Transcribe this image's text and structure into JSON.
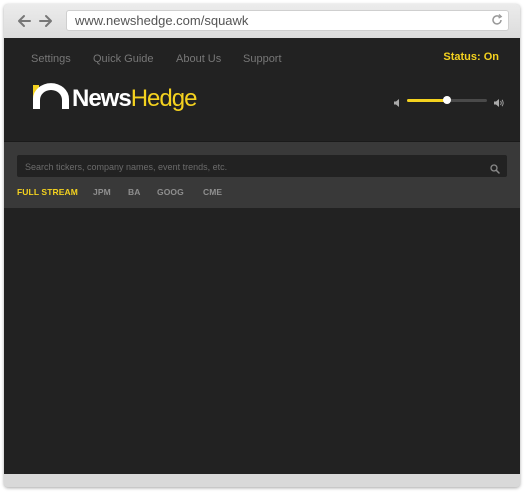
{
  "browser": {
    "url": "www.newshedge.com/squawk",
    "icons": {
      "back": "back-arrow-icon",
      "forward": "forward-arrow-icon",
      "reload": "reload-icon"
    }
  },
  "nav": {
    "links": [
      "Settings",
      "Quick Guide",
      "About Us",
      "Support"
    ],
    "status": "Status: On"
  },
  "logo": {
    "part1": "News",
    "part2": "Hedge"
  },
  "volume": {
    "level": 0.5
  },
  "search": {
    "placeholder": "Search tickers, company names, event trends, etc."
  },
  "tabs": [
    "FULL STREAM",
    "JPM",
    "BA",
    "GOOG",
    "CME"
  ],
  "active_tab": "FULL STREAM",
  "colors": {
    "accent": "#f4d21f",
    "background": "#222222",
    "panel": "#393939"
  }
}
